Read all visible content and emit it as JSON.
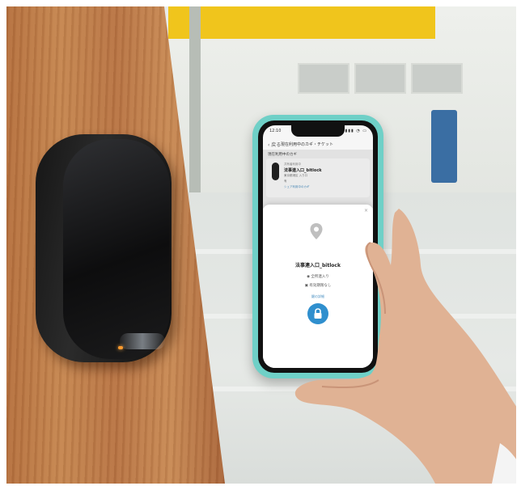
{
  "scene": {
    "description_subject": "smart lock",
    "colors": {
      "door_wood": "#b87444",
      "lock_body": "#161616",
      "lock_led": "#ff9b2e",
      "phone_case": "#6fd0c7",
      "unlock_button": "#2f8fce",
      "sign_yellow": "#f0c51c"
    }
  },
  "phone": {
    "status_time": "12:10",
    "status_icons": "▮▮▮ ◔ ▭",
    "nav": {
      "back": "‹ 戻る",
      "title": "現在利用中のカギ・チケット"
    },
    "section_header": "現在利用中のカギ",
    "card": {
      "subtitle": "共有者利用中",
      "name": "法事連入口_bitlock",
      "line1": "東京都港区 入り口",
      "line2": "有",
      "line3": "シェア利用中のカギ"
    },
    "sheet": {
      "close": "×",
      "pin_icon": "location-pin-icon",
      "name": "法事連入口_bitlock",
      "row_a": "◉ 全所連入り",
      "row_b": "▣ 有効期限なし",
      "detail_link": "鍵の詳細",
      "unlock_icon": "padlock-icon"
    }
  }
}
